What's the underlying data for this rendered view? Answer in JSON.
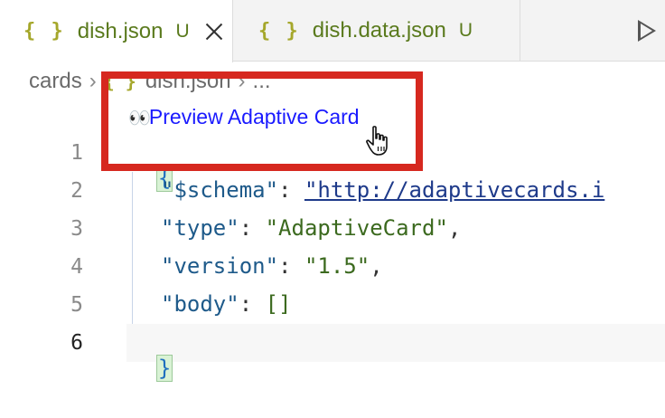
{
  "tabs": [
    {
      "braces": "{ }",
      "filename": "dish.json",
      "badge": "U",
      "active": true
    },
    {
      "braces": "{ }",
      "filename": "dish.data.json",
      "badge": "U",
      "active": false
    }
  ],
  "breadcrumb": {
    "folder": "cards",
    "sep": "›",
    "braces": "{ }",
    "file": "dish.json",
    "sep2": "›",
    "more": "..."
  },
  "codelens": {
    "eyes": "👀",
    "label": "Preview Adaptive Card"
  },
  "editor": {
    "active_line": "6",
    "lines": [
      {
        "num": "1"
      },
      {
        "num": "2",
        "key": "\"$schema\"",
        "colon": ": ",
        "value": "\"http://adaptivecards.i"
      },
      {
        "num": "3",
        "key": "\"type\"",
        "colon": ": ",
        "value": "\"AdaptiveCard\"",
        "tail": ","
      },
      {
        "num": "4",
        "key": "\"version\"",
        "colon": ": ",
        "value": "\"1.5\"",
        "tail": ","
      },
      {
        "num": "5",
        "key": "\"body\"",
        "colon": ": ",
        "value": "[]"
      },
      {
        "num": "6"
      }
    ],
    "open_brace": "{",
    "close_brace": "}"
  },
  "colors": {
    "highlight_border": "#d6281f",
    "link": "#1a1aff",
    "git_untracked": "#5a7a1d"
  },
  "icons": [
    "json-braces-icon",
    "close-icon",
    "run-icon",
    "hand-pointer-cursor-icon"
  ]
}
